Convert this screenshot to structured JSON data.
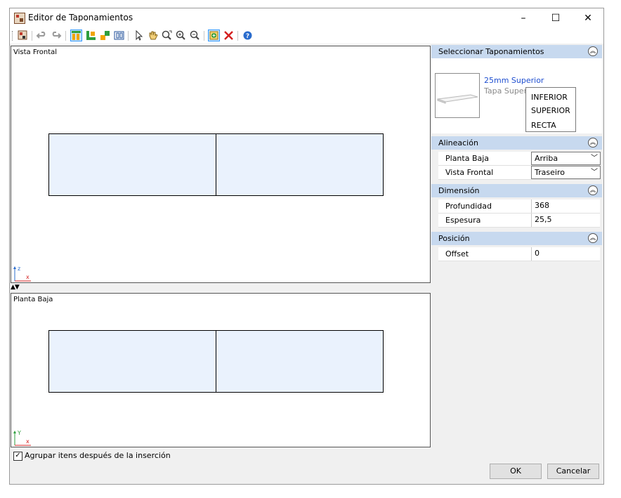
{
  "window": {
    "title": "Editor de Taponamientos",
    "minimize": "–",
    "maximize": "☐",
    "close": "✕"
  },
  "views": {
    "front": {
      "label": "Vista Frontal",
      "axis_v": "z",
      "axis_h": "x"
    },
    "plan": {
      "label": "Planta Baja",
      "axis_v": "Y",
      "axis_h": "x"
    },
    "splitter": "▲▼"
  },
  "panel": {
    "select": {
      "header": "Seleccionar Taponamientos",
      "item_title": "25mm Superior",
      "item_subtitle": "Tapa Super",
      "menu": [
        "INFERIOR",
        "SUPERIOR",
        "RECTA"
      ]
    },
    "alignment": {
      "header": "Alineación",
      "rows": [
        {
          "label": "Planta Baja",
          "value": "Arriba"
        },
        {
          "label": "Vista Frontal",
          "value": "Traseiro"
        }
      ]
    },
    "dimension": {
      "header": "Dimensión",
      "rows": [
        {
          "label": "Profundidad",
          "value": "368"
        },
        {
          "label": "Espesura",
          "value": "25,5"
        }
      ]
    },
    "position": {
      "header": "Posición",
      "rows": [
        {
          "label": "Offset",
          "value": "0"
        }
      ]
    }
  },
  "footer": {
    "group_checkbox_label": "Agrupar itens después de la inserción",
    "group_checked": true,
    "ok": "OK",
    "cancel": "Cancelar"
  }
}
